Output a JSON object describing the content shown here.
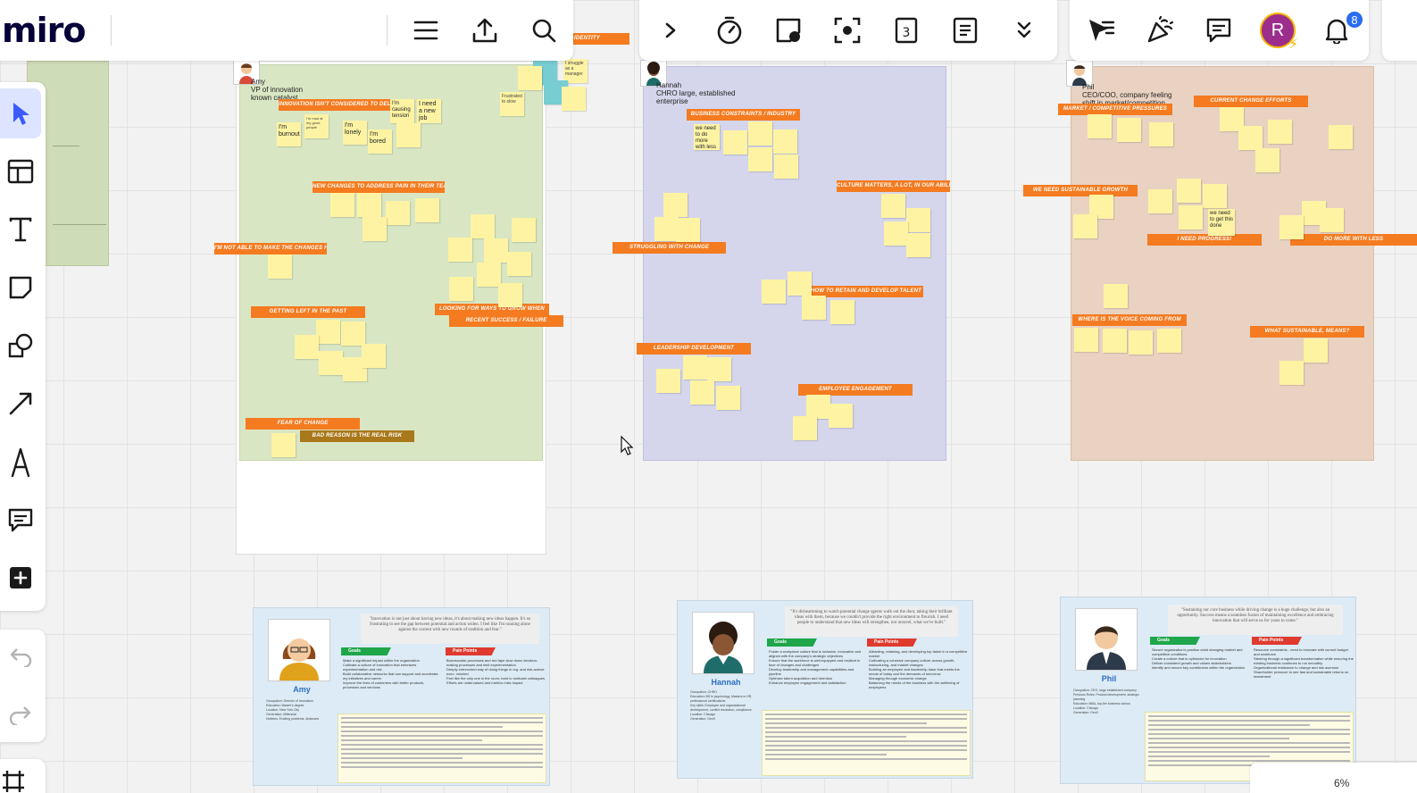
{
  "app": {
    "logo": "miro"
  },
  "toolbar_center": {
    "icons": [
      "chevron-right-icon",
      "timer-icon",
      "sticker-icon",
      "focus-icon",
      "calendar-icon",
      "notes-icon",
      "chevron-double-down-icon"
    ]
  },
  "toolbar_right": {
    "avatar_initial": "R",
    "notification_count": "8"
  },
  "zoom": {
    "level": "6%"
  },
  "frames": {
    "amy": {
      "header": [
        "Amy",
        "VP of innovation",
        "known catalyst"
      ],
      "stickies": [
        "I'm burnout",
        "I'm lonely",
        "I'm bored",
        "I'm causing tension",
        "I need a new job",
        "I'm mad at my good people",
        "I struggle as a manager",
        "Frustrated to slow"
      ],
      "tags": [
        "INNOVATION ISN'T CONSIDERED TO DELIVER VALUE",
        "NEW CHANGES TO ADDRESS PAIN IN THEIR TEAMS",
        "I'M NOT ABLE TO MAKE THE CHANGES HAPPEN ALONE",
        "GETTING LEFT IN THE PAST",
        "LOOKING FOR WAYS TO GROW WHEN",
        "RECENT SUCCESS / FAILURE",
        "FEAR OF CHANGE",
        "BAD REASON IS THE REAL RISK",
        "IDENTITY"
      ]
    },
    "hannah": {
      "header": [
        "Hannah",
        "CHRO large, established",
        "enterprise"
      ],
      "stickies": [
        "we need to do more with less"
      ],
      "tags": [
        "BUSINESS CONSTRAINTS / INDUSTRY",
        "CULTURE MATTERS, A LOT, IN OUR ABILITY TO SUCCEED",
        "STRUGGLING WITH CHANGE",
        "HOW TO RETAIN AND DEVELOP TALENT",
        "LEADERSHIP DEVELOPMENT",
        "EMPLOYEE ENGAGEMENT"
      ]
    },
    "phil": {
      "header": [
        "Phil",
        "CEO/COO, company feeling",
        "shift in market/competition"
      ],
      "stickies": [
        "we need to get this done"
      ],
      "tags": [
        "MARKET / COMPETITIVE PRESSURES",
        "CURRENT CHANGE EFFORTS",
        "WE NEED SUSTAINABLE GROWTH",
        "I NEED PROGRESS!",
        "DO MORE WITH LESS",
        "WHERE IS THE VOICE COMING FROM",
        "WHAT SUSTAINABLE, MEANS?"
      ]
    }
  },
  "personas": {
    "amy": {
      "name": "Amy",
      "quote": "\"Innovation is not just about having new ideas, it's about making new ideas happen. It's so frustrating to see the gap between potential and action widen. I feel like I'm running alone against the current with new rounds of tradition and fear.\"",
      "goals_label": "Goals",
      "pains_label": "Pain Points",
      "goals": [
        "Make a significant impact within the organization",
        "Cultivate a culture of innovation that embraces experimentation and risk",
        "Build collaborative networks that can support and accelerate my initiatives and career",
        "Improve the lives of customers with better products, processes and services"
      ],
      "pains": [
        "Bureaucratic processes and red tape slow down decision-making processes and limit experimentation",
        "Deeply entrenched way of doing things in org. and risk-averse exec. mindset",
        "Feel like the only one in the room; hard to motivate colleagues",
        "Efforts are undervalued and metrics miss impact"
      ],
      "meta": [
        "Occupation: Director of Innovation",
        "Education: Master's degree",
        "Location: New York City",
        "Generation: Millennial",
        "Hobbies: Exciting problems, distances"
      ]
    },
    "hannah": {
      "name": "Hannah",
      "quote": "\"It's disheartening to watch potential change agents walk out the door, taking their brilliant ideas with them, because we couldn't provide the right environment to flourish. I need people to understand that new ideas will strengthen, not unravel, what we've built.\"",
      "goals_label": "Goals",
      "pains_label": "Pain Points",
      "goals": [
        "Foster a workplace culture that is inclusive, innovative and aligned with the company's strategic objectives",
        "Ensure that the workforce is well-equipped and resilient in face of changes and challenges",
        "Develop leadership and management capabilities and pipeline",
        "Optimize talent acquisition and retention",
        "Enhance employee engagement and satisfaction"
      ],
      "pains": [
        "Attracting, retaining, and developing top talent in a competitive market",
        "Cultivating a cohesive company culture across growth, restructuring, and market changes",
        "Building an employee and leadership base that meets the needs of today and the demands of tomorrow",
        "Managing through economic change",
        "Balancing the needs of the business with the wellbeing of employees"
      ],
      "meta": [
        "Occupation: CHRO",
        "Education: BS in psychology, Masters in HR, professional certifications",
        "Key skills: Employee and organizational development, conflict resolution, compliance",
        "Location: Chicago",
        "Generation: GenX"
      ]
    },
    "phil": {
      "name": "Phil",
      "quote": "\"Sustaining our core business while driving change is a huge challenge, but also an opportunity. Success means a seamless fusion of maintaining excellence and embracing innovation that will serve us for years to come.\"",
      "goals_label": "Goals",
      "pains_label": "Pain Points",
      "goals": [
        "Secure organization's position amid changing market and competitive conditions",
        "Create a culture that is optimized for innovation",
        "Deliver consistent growth and values stakeholders",
        "Identify and secure key contributors within the organization"
      ],
      "pains": [
        "Resource constraints - need to innovate with current budget and workforce",
        "Steering through a significant transformation while ensuring the existing business continues to run smoothly",
        "Organizational resistance to change and risk aversion",
        "Shareholder pressure to see fast and sustainable returns on investment"
      ],
      "meta": [
        "Occupation: CEO, large established company",
        "Previous Roles: Product development, strategic planning",
        "Education: MBA, top-tier business school",
        "Location: Chicago",
        "Generation: GenX"
      ]
    }
  }
}
